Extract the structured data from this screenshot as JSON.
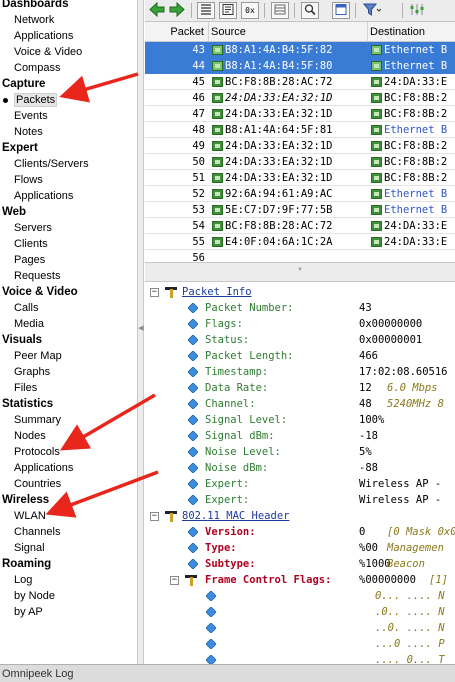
{
  "sidebar": {
    "sections": [
      {
        "title": "Dashboards",
        "items": [
          {
            "label": "Network"
          },
          {
            "label": "Applications"
          },
          {
            "label": "Voice & Video"
          },
          {
            "label": "Compass"
          }
        ]
      },
      {
        "title": "Capture",
        "items": [
          {
            "label": "Packets",
            "active": true
          },
          {
            "label": "Events"
          },
          {
            "label": "Notes"
          }
        ]
      },
      {
        "title": "Expert",
        "items": [
          {
            "label": "Clients/Servers"
          },
          {
            "label": "Flows"
          },
          {
            "label": "Applications"
          }
        ]
      },
      {
        "title": "Web",
        "items": [
          {
            "label": "Servers"
          },
          {
            "label": "Clients"
          },
          {
            "label": "Pages"
          },
          {
            "label": "Requests"
          }
        ]
      },
      {
        "title": "Voice & Video",
        "items": [
          {
            "label": "Calls"
          },
          {
            "label": "Media"
          }
        ]
      },
      {
        "title": "Visuals",
        "items": [
          {
            "label": "Peer Map"
          },
          {
            "label": "Graphs"
          },
          {
            "label": "Files"
          }
        ]
      },
      {
        "title": "Statistics",
        "items": [
          {
            "label": "Summary"
          },
          {
            "label": "Nodes"
          },
          {
            "label": "Protocols"
          },
          {
            "label": "Applications"
          },
          {
            "label": "Countries"
          }
        ]
      },
      {
        "title": "Wireless",
        "items": [
          {
            "label": "WLAN"
          },
          {
            "label": "Channels"
          },
          {
            "label": "Signal"
          }
        ]
      },
      {
        "title": "Roaming",
        "items": [
          {
            "label": "Log"
          },
          {
            "label": "by Node"
          },
          {
            "label": "by AP"
          }
        ]
      }
    ]
  },
  "toolbar": {
    "buttons": [
      {
        "icon": "back-arrow-icon"
      },
      {
        "icon": "forward-arrow-icon"
      },
      {
        "icon": "decode-view-icon"
      },
      {
        "icon": "list-view-icon"
      },
      {
        "icon": "hex-view-icon",
        "label": "0x"
      },
      {
        "icon": "grid-view-icon"
      },
      {
        "icon": "find-icon"
      },
      {
        "icon": "layout-icon"
      },
      {
        "icon": "filter-icon"
      },
      {
        "icon": "options-icon"
      }
    ]
  },
  "packet_list": {
    "columns": [
      "Packet",
      "Source",
      "Destination"
    ],
    "rows": [
      {
        "num": "43",
        "src": "B8:A1:4A:B4:5F:82",
        "dst": "Ethernet B",
        "selected": true,
        "dst_style": "blue"
      },
      {
        "num": "44",
        "src": "B8:A1:4A:B4:5F:80",
        "dst": "Ethernet B",
        "selected": true,
        "dst_style": "blue"
      },
      {
        "num": "45",
        "src": "BC:F8:8B:28:AC:72",
        "dst": "24:DA:33:E",
        "selected": false,
        "dst_style": "plain"
      },
      {
        "num": "46",
        "src": "24:DA:33:EA:32:1D",
        "dst": "BC:F8:8B:2",
        "selected": false,
        "dst_style": "plain",
        "src_style": "italic"
      },
      {
        "num": "47",
        "src": "24:DA:33:EA:32:1D",
        "dst": "BC:F8:8B:2",
        "selected": false,
        "dst_style": "plain"
      },
      {
        "num": "48",
        "src": "B8:A1:4A:64:5F:81",
        "dst": "Ethernet B",
        "selected": false,
        "dst_style": "blue"
      },
      {
        "num": "49",
        "src": "24:DA:33:EA:32:1D",
        "dst": "BC:F8:8B:2",
        "selected": false,
        "dst_style": "plain"
      },
      {
        "num": "50",
        "src": "24:DA:33:EA:32:1D",
        "dst": "BC:F8:8B:2",
        "selected": false,
        "dst_style": "plain"
      },
      {
        "num": "51",
        "src": "24:DA:33:EA:32:1D",
        "dst": "BC:F8:8B:2",
        "selected": false,
        "dst_style": "plain"
      },
      {
        "num": "52",
        "src": "92:6A:94:61:A9:AC",
        "dst": "Ethernet B",
        "selected": false,
        "dst_style": "blue"
      },
      {
        "num": "53",
        "src": "5E:C7:D7:9F:77:5B",
        "dst": "Ethernet B",
        "selected": false,
        "dst_style": "blue"
      },
      {
        "num": "54",
        "src": "BC:F8:8B:28:AC:72",
        "dst": "24:DA:33:E",
        "selected": false,
        "dst_style": "plain"
      },
      {
        "num": "55",
        "src": "E4:0F:04:6A:1C:2A",
        "dst": "24:DA:33:E",
        "selected": false,
        "dst_style": "plain"
      },
      {
        "num": "56",
        "src": "",
        "dst": "",
        "selected": false,
        "dst_style": "plain",
        "partial": true
      }
    ]
  },
  "decode": {
    "packet_info": {
      "title": "Packet Info",
      "fields": [
        {
          "name": "Packet Number:",
          "value": "43"
        },
        {
          "name": "Flags:",
          "value": "0x00000000"
        },
        {
          "name": "Status:",
          "value": "0x00000001"
        },
        {
          "name": "Packet Length:",
          "value": "466"
        },
        {
          "name": "Timestamp:",
          "value": "17:02:08.60516"
        },
        {
          "name": "Data Rate:",
          "value": "12",
          "ext": "6.0 Mbps"
        },
        {
          "name": "Channel:",
          "value": "48",
          "ext": "5240MHz  8"
        },
        {
          "name": "Signal Level:",
          "value": "100%"
        },
        {
          "name": "Signal dBm:",
          "value": "-18"
        },
        {
          "name": "Noise Level:",
          "value": "5%"
        },
        {
          "name": "Noise dBm:",
          "value": "-88"
        },
        {
          "name": "Expert:",
          "value": "Wireless AP -"
        },
        {
          "name": "Expert:",
          "value": "Wireless AP -"
        }
      ]
    },
    "mac_header": {
      "title": "802.11 MAC Header",
      "fields": [
        {
          "name": "Version:",
          "value": "0",
          "ext": "[0 Mask 0x03"
        },
        {
          "name": "Type:",
          "value": "%00",
          "ext": "Managemen"
        },
        {
          "name": "Subtype:",
          "value": "%1000",
          "ext": "Beacon"
        }
      ],
      "fcf": {
        "name": "Frame Control Flags:",
        "value": "%00000000",
        "ext": "[1]",
        "bits": [
          "0... .... N",
          ".0.. .... N",
          "..0. .... N",
          "...0 .... P",
          ".... 0... T"
        ]
      }
    }
  },
  "statusbar": {
    "text": "Omnipeek Log"
  }
}
